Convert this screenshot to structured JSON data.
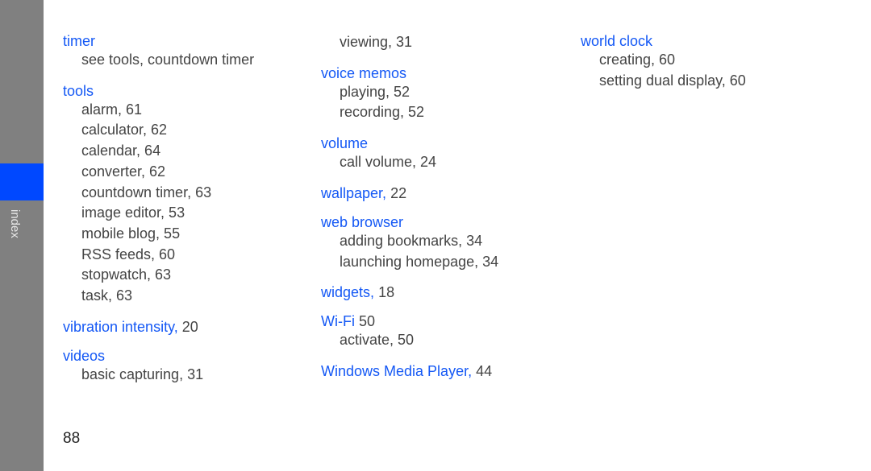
{
  "sidebar": {
    "label": "index",
    "accent": "#0048ff"
  },
  "columns": [
    [
      {
        "head": "timer",
        "page": "",
        "subs": [
          "see tools, countdown timer"
        ]
      },
      {
        "head": "tools",
        "page": "",
        "subs": [
          "alarm,  61",
          "calculator,  62",
          "calendar,  64",
          "converter,  62",
          "countdown timer,  63",
          "image editor,  53",
          "mobile blog,  55",
          "RSS feeds,  60",
          "stopwatch,  63",
          "task,  63"
        ]
      },
      {
        "head": "vibration intensity,",
        "page": "20",
        "subs": []
      },
      {
        "head": "videos",
        "page": "",
        "subs": [
          "basic capturing,  31"
        ]
      }
    ],
    [
      {
        "head": "",
        "page": "",
        "subs": [
          "viewing,  31"
        ]
      },
      {
        "head": "voice memos",
        "page": "",
        "subs": [
          "playing,  52",
          "recording,  52"
        ]
      },
      {
        "head": "volume",
        "page": "",
        "subs": [
          "call volume,  24"
        ]
      },
      {
        "head": "wallpaper,",
        "page": "22",
        "subs": []
      },
      {
        "head": "web browser",
        "page": "",
        "subs": [
          "adding bookmarks,  34",
          "launching homepage,  34"
        ]
      },
      {
        "head": "widgets,",
        "page": "18",
        "subs": []
      },
      {
        "head": "Wi-Fi",
        "page": "50",
        "subs": [
          "activate,  50"
        ]
      },
      {
        "head": "Windows Media Player,",
        "page": "44",
        "subs": []
      }
    ],
    [
      {
        "head": "world clock",
        "page": "",
        "subs": [
          "creating,  60",
          "setting dual display,  60"
        ]
      }
    ]
  ],
  "page_number": "88"
}
